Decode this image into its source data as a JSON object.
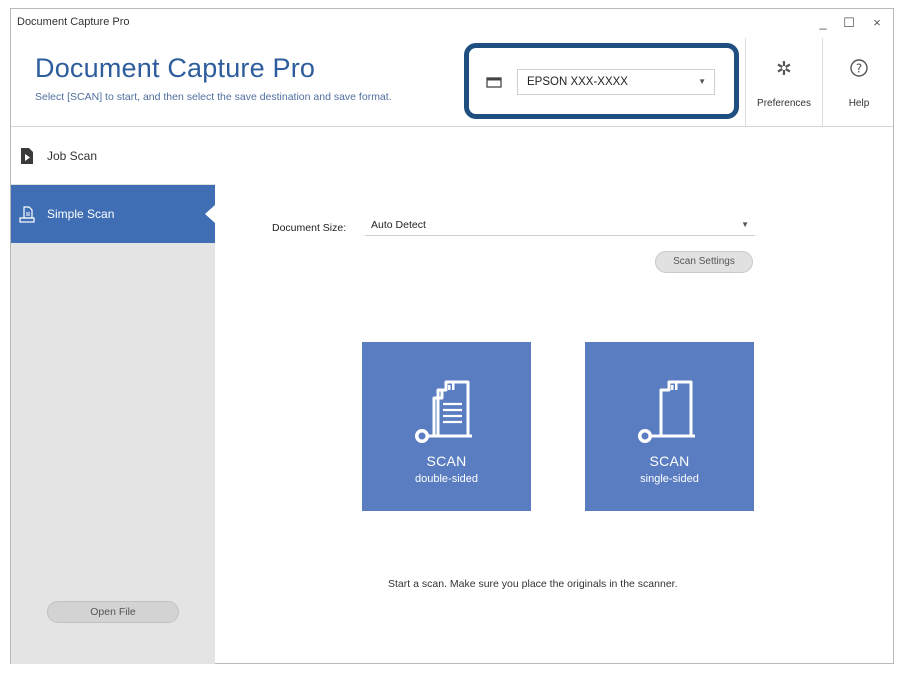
{
  "window": {
    "title": "Document Capture Pro",
    "minimize_glyph": "_",
    "maximize_glyph": "☐",
    "close_glyph": "×"
  },
  "header": {
    "app_title": "Document Capture Pro",
    "subtitle": "Select [SCAN] to start, and then select the save destination and save format.",
    "scanner": {
      "selected": "EPSON XXX-XXXX",
      "icon": "scanner-icon",
      "highlight_color": "#1f4f80"
    },
    "preferences_label": "Preferences",
    "preferences_icon": "gear-icon",
    "help_label": "Help",
    "help_icon": "help-icon"
  },
  "sidebar": {
    "items": [
      {
        "label": "Job Scan",
        "icon": "job-scan-icon",
        "selected": false
      },
      {
        "label": "Simple Scan",
        "icon": "simple-scan-icon",
        "selected": true
      }
    ],
    "open_file_label": "Open File"
  },
  "main": {
    "document_size_label": "Document Size:",
    "document_size_value": "Auto Detect",
    "scan_settings_label": "Scan Settings",
    "scan_buttons": [
      {
        "title": "SCAN",
        "subtitle": "double-sided",
        "icon": "double-sided-scan-icon"
      },
      {
        "title": "SCAN",
        "subtitle": "single-sided",
        "icon": "single-sided-scan-icon"
      }
    ],
    "hint": "Start a scan. Make sure you place the originals in the scanner."
  },
  "colors": {
    "accent": "#3f6eb4",
    "tile": "#5a7dc1",
    "title_text": "#2d5d9c"
  }
}
